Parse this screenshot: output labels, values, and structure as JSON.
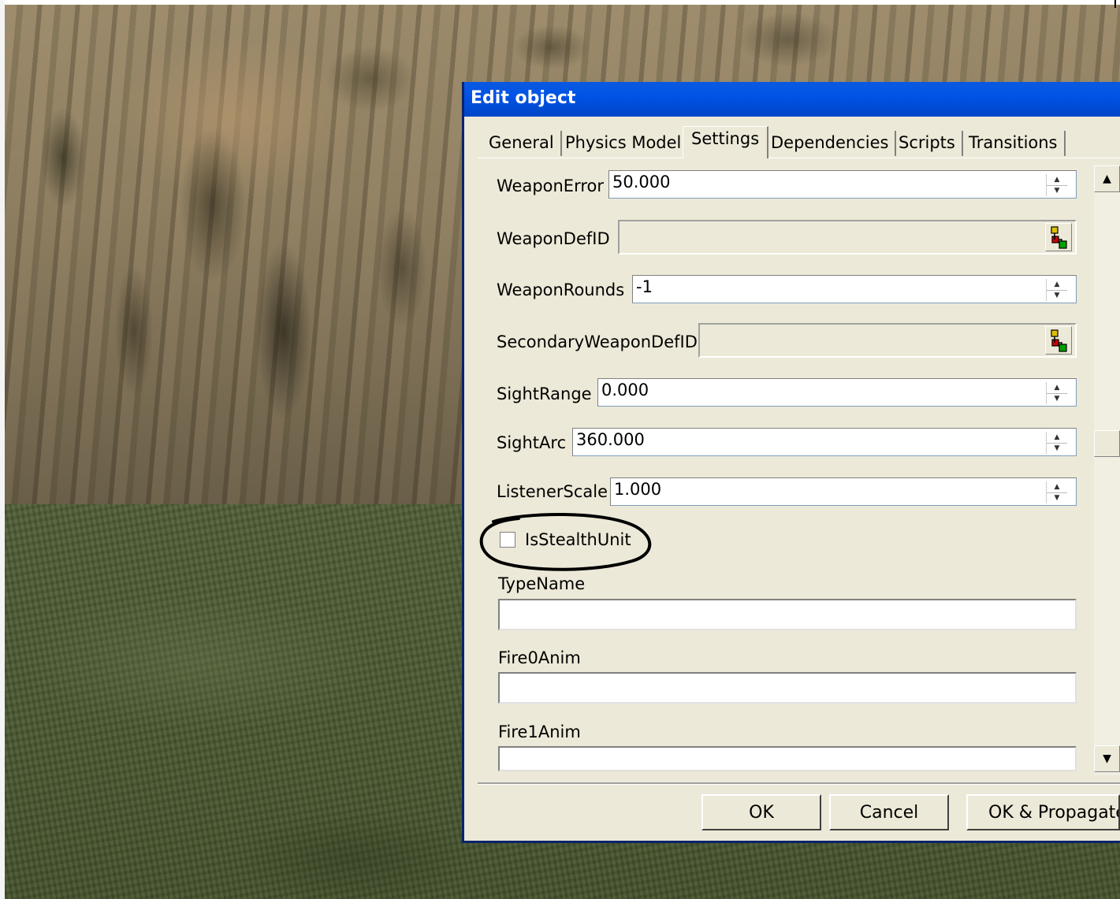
{
  "dialog": {
    "title": "Edit object",
    "tabs": [
      {
        "label": "General",
        "active": false
      },
      {
        "label": "Physics Model",
        "active": false
      },
      {
        "label": "Settings",
        "active": true
      },
      {
        "label": "Dependencies",
        "active": false
      },
      {
        "label": "Scripts",
        "active": false
      },
      {
        "label": "Transitions",
        "active": false
      }
    ],
    "fields": {
      "weapon_error": {
        "label": "WeaponError",
        "value": "50.000"
      },
      "weapon_def_id": {
        "label": "WeaponDefID",
        "value": ""
      },
      "weapon_rounds": {
        "label": "WeaponRounds",
        "value": "-1"
      },
      "secondary_weapon_def_id": {
        "label": "SecondaryWeaponDefID",
        "value": ""
      },
      "sight_range": {
        "label": "SightRange",
        "value": "0.000"
      },
      "sight_arc": {
        "label": "SightArc",
        "value": "360.000"
      },
      "listener_scale": {
        "label": "ListenerScale",
        "value": "1.000"
      },
      "is_stealth_unit": {
        "label": "IsStealthUnit",
        "checked": false
      },
      "type_name": {
        "label": "TypeName",
        "value": ""
      },
      "fire0_anim": {
        "label": "Fire0Anim",
        "value": ""
      },
      "fire1_anim": {
        "label": "Fire1Anim",
        "value": ""
      }
    },
    "buttons": {
      "ok": "OK",
      "cancel": "Cancel",
      "ok_propagate": "OK & Propagate..."
    },
    "scroll_position_fraction": 0.45,
    "icons": {
      "picker": "tree-picker-icon",
      "scroll_up": "scroll-up-arrow-icon",
      "scroll_down": "scroll-down-arrow-icon"
    },
    "annotation": {
      "shape": "hand-drawn-ellipse",
      "color": "#000000",
      "target": "IsStealthUnit"
    }
  },
  "colors": {
    "titlebar": "#0053e6",
    "dialog_face": "#ece9d8",
    "title_text": "#ffffff"
  }
}
